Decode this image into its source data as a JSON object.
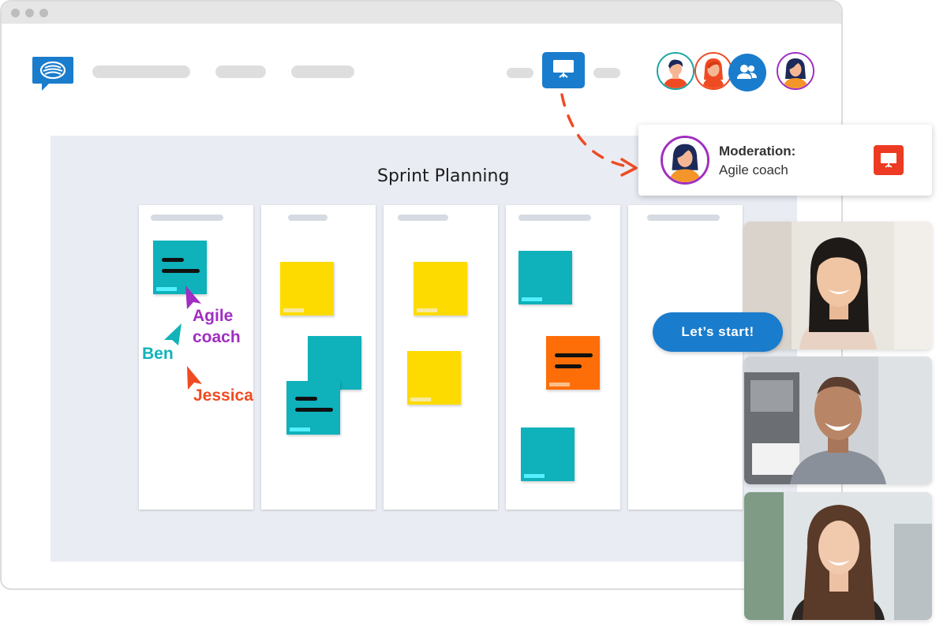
{
  "app": {
    "logo_icon": "chat-bubble-logo-icon",
    "present_icon": "presentation-icon",
    "participants_icon": "participants-icon"
  },
  "board": {
    "title": "Sprint Planning"
  },
  "cursors": [
    {
      "name": "Agile coach",
      "lines": [
        "Agile",
        "coach"
      ],
      "color": "#a12ec2"
    },
    {
      "name": "Ben",
      "color": "#11b3b8"
    },
    {
      "name": "Jessica",
      "color": "#ef4b23"
    }
  ],
  "moderation": {
    "title": "Moderation:",
    "role": "Agile coach",
    "icon": "presentation-icon"
  },
  "video": {
    "bubble_text": "Let’s start!"
  },
  "colors": {
    "accent_blue": "#1a7ccc",
    "teal_note": "#0fb1bb",
    "yellow_note": "#fedb00",
    "orange_note": "#fd6e08",
    "moderation_red": "#ed3a23",
    "board_bg": "#e9edf3"
  }
}
